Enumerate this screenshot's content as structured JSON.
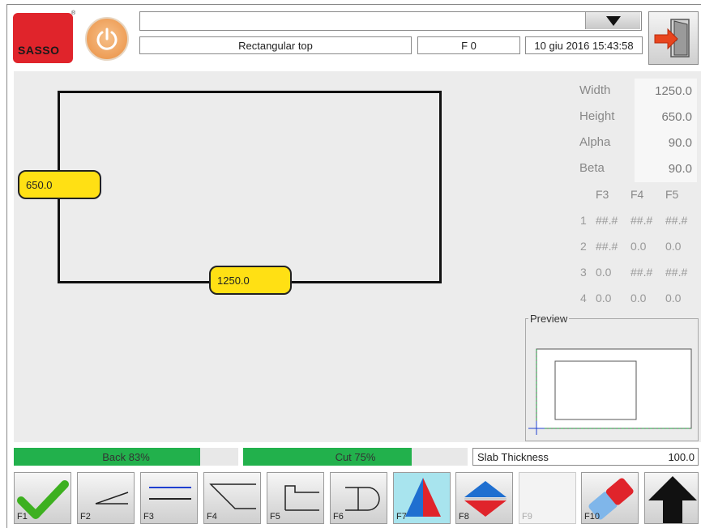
{
  "header": {
    "logo_text": "SASSO",
    "logo_reg": "®",
    "combo_value": "",
    "program_name": "Rectangular top",
    "function_code": "F 0",
    "datetime": "10 giu 2016 15:43:58"
  },
  "drawing": {
    "height_label": "650.0",
    "width_label": "1250.0"
  },
  "params": [
    {
      "label": "Width",
      "value": "1250.0"
    },
    {
      "label": "Height",
      "value": "650.0"
    },
    {
      "label": "Alpha",
      "value": "90.0"
    },
    {
      "label": "Beta",
      "value": "90.0"
    }
  ],
  "grid": {
    "headers": [
      "F3",
      "F4",
      "F5"
    ],
    "rows": [
      {
        "num": "1",
        "cells": [
          "##.#",
          "##.#",
          "##.#"
        ]
      },
      {
        "num": "2",
        "cells": [
          "##.#",
          "0.0",
          "0.0"
        ]
      },
      {
        "num": "3",
        "cells": [
          "0.0",
          "##.#",
          "##.#"
        ]
      },
      {
        "num": "4",
        "cells": [
          "0.0",
          "0.0",
          "0.0"
        ]
      }
    ]
  },
  "preview": {
    "title": "Preview"
  },
  "status": {
    "back_label": "Back 83%",
    "back_percent": 83,
    "cut_label": "Cut 75%",
    "cut_percent": 75,
    "slab_label": "Slab Thickness",
    "slab_value": "100.0"
  },
  "fkeys": [
    {
      "label": "F1",
      "icon": "checkmark-icon"
    },
    {
      "label": "F2",
      "icon": "angled-line-icon"
    },
    {
      "label": "F3",
      "icon": "parallel-lines-icon"
    },
    {
      "label": "F4",
      "icon": "bevel-corner-icon"
    },
    {
      "label": "F5",
      "icon": "notch-profile-icon"
    },
    {
      "label": "F6",
      "icon": "rounded-end-icon"
    },
    {
      "label": "F7",
      "icon": "triangle-split-icon"
    },
    {
      "label": "F8",
      "icon": "diamond-split-icon"
    },
    {
      "label": "F9",
      "icon": "empty"
    },
    {
      "label": "F10",
      "icon": "eraser-icon"
    },
    {
      "label": "",
      "icon": "up-arrow-icon"
    }
  ],
  "colors": {
    "accent_yellow": "#ffe014",
    "progress_green": "#22b14c",
    "logo_red": "#e0242b",
    "active_key": "#a8e4ee"
  }
}
